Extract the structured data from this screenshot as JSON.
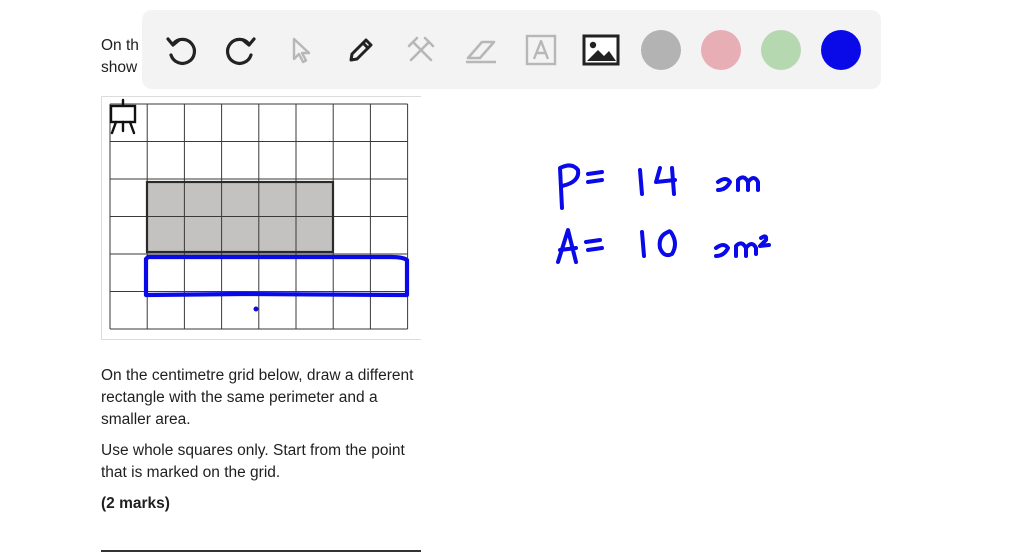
{
  "intro_text": "On th\nshow",
  "toolbar": {
    "tools": [
      "undo-icon",
      "redo-icon",
      "select-cursor-icon",
      "pen-icon",
      "tools-icon",
      "eraser-icon",
      "text-tool-icon",
      "image-icon"
    ],
    "colors": [
      {
        "name": "gray",
        "hex": "#b3b3b3"
      },
      {
        "name": "pink",
        "hex": "#e8aeb5"
      },
      {
        "name": "green",
        "hex": "#b5d8b1"
      },
      {
        "name": "blue",
        "hex": "#0a0ae8"
      }
    ],
    "selected_color": "blue"
  },
  "grid": {
    "columns": 8,
    "rows": 6,
    "shaded_rect": {
      "col": 1,
      "row": 2,
      "width": 5,
      "height": 2
    }
  },
  "question": {
    "para1": "On the centimetre grid below, draw a different rectangle with the same perimeter and a smaller area.",
    "para2": "Use whole squares only. Start from the point that is marked on the grid.",
    "marks": "(2 marks)"
  },
  "handwriting": {
    "line1": "P= 14 cm",
    "line2": "A= 10 cm²",
    "ink_color": "#0a0ae8"
  }
}
